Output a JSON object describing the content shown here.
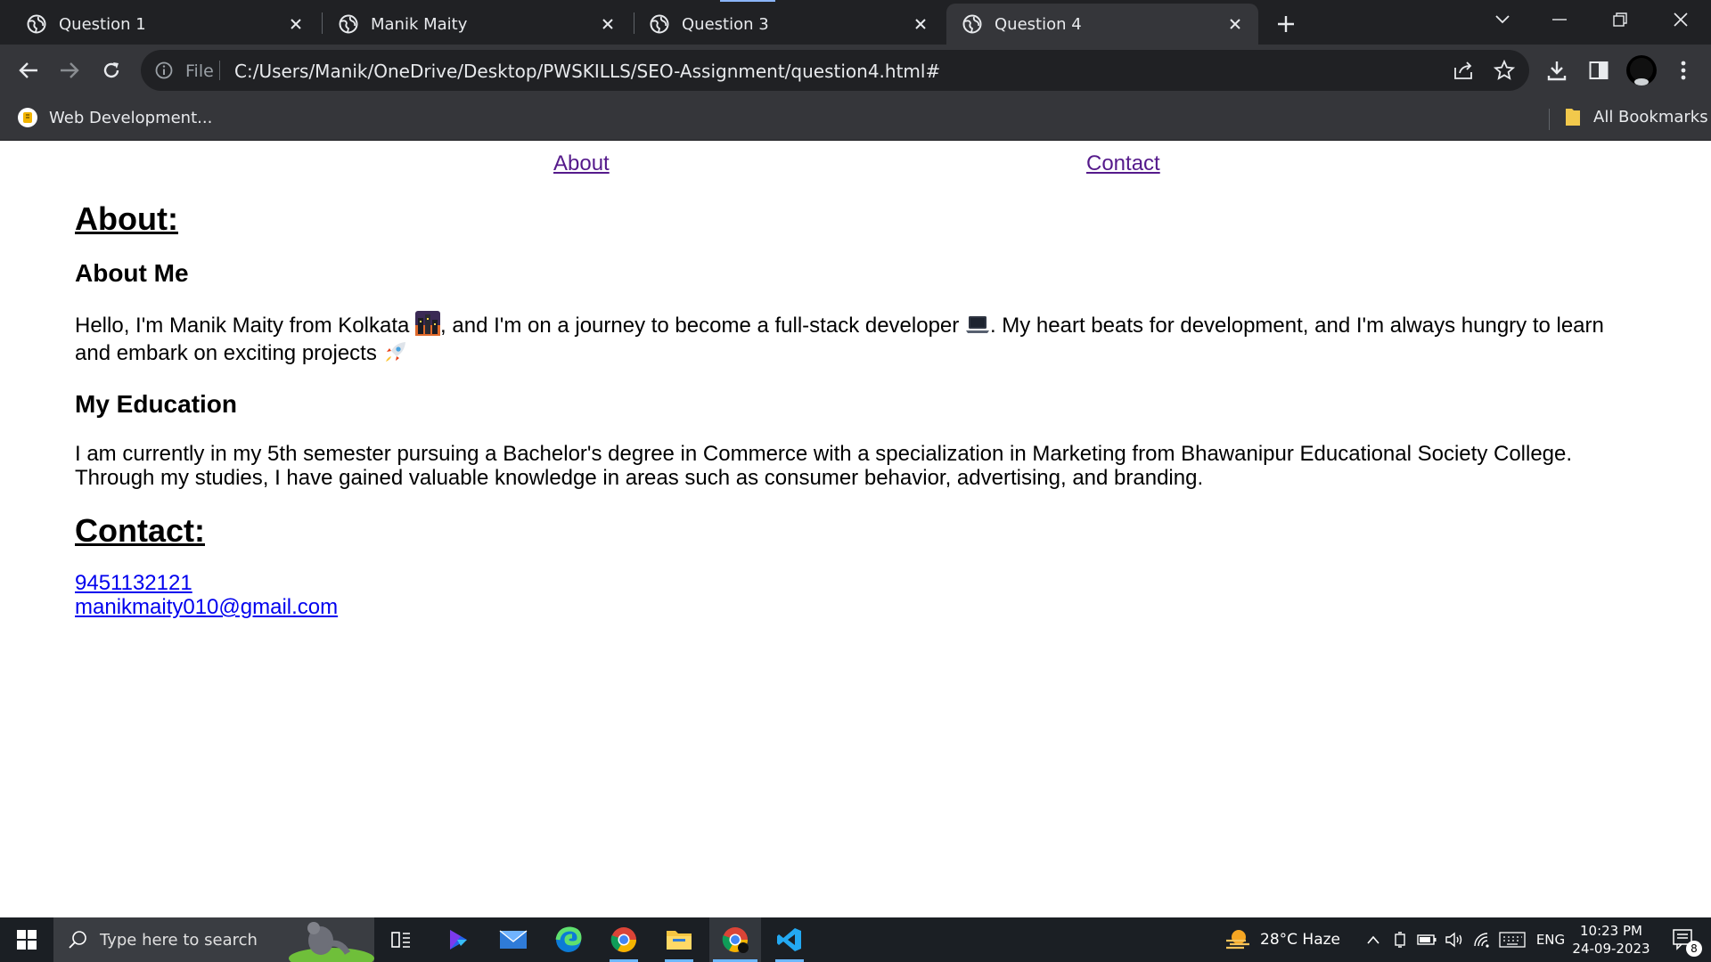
{
  "tabs": [
    {
      "title": "Question 1",
      "active": false
    },
    {
      "title": "Manik Maity",
      "active": false
    },
    {
      "title": "Question 3",
      "active": false
    },
    {
      "title": "Question 4",
      "active": true
    }
  ],
  "toolbar": {
    "omnibox_scheme": "File",
    "url": "C:/Users/Manik/OneDrive/Desktop/PWSKILLS/SEO-Assignment/question4.html#"
  },
  "bookmarks": {
    "item": "Web Development...",
    "all_bookmarks": "All Bookmarks"
  },
  "page": {
    "nav": {
      "about": "About",
      "contact": "Contact"
    },
    "about_heading": "About:",
    "about_me_heading": "About Me",
    "about_me_text_1": "Hello, I'm Manik Maity from Kolkata",
    "about_me_text_2": ", and I'm on a journey to become a full-stack developer",
    "about_me_text_3": ". My heart beats for development, and I'm always hungry to learn and embark on exciting projects",
    "education_heading": "My Education",
    "education_text": "I am currently in my 5th semester pursuing a Bachelor's degree in Commerce with a specialization in Marketing from Bhawanipur Educational Society College. Through my studies, I have gained valuable knowledge in areas such as consumer behavior, advertising, and branding.",
    "contact_heading": "Contact:",
    "phone": "9451132121",
    "email": "manikmaity010@gmail.com"
  },
  "taskbar": {
    "search_placeholder": "Type here to search",
    "weather": "28°C  Haze",
    "language": "ENG",
    "time": "10:23 PM",
    "date": "24-09-2023",
    "notifications": "8"
  },
  "colors": {
    "link_visited": "#551a8b",
    "link": "#0000ee",
    "chrome_dark": "#202124",
    "chrome_toolbar": "#35363a"
  }
}
